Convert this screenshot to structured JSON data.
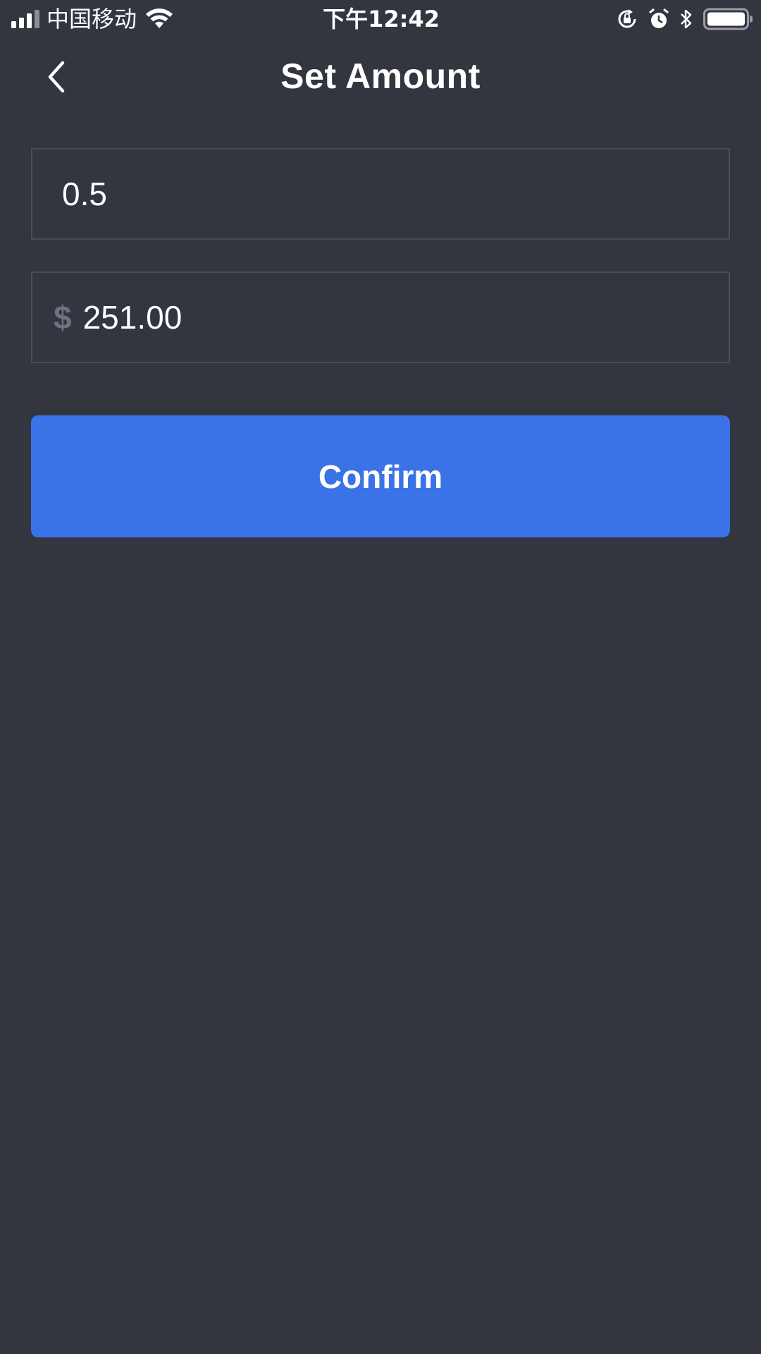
{
  "status_bar": {
    "carrier": "中国移动",
    "time": "下午12:42",
    "icons": [
      "signal-icon",
      "wifi-icon",
      "orientation-lock-icon",
      "alarm-icon",
      "bluetooth-icon",
      "battery-icon"
    ]
  },
  "nav": {
    "title": "Set Amount",
    "back_icon": "chevron-left-icon"
  },
  "form": {
    "amount_value": "0.5",
    "fiat_symbol": "$",
    "fiat_value": "251.00"
  },
  "actions": {
    "confirm_label": "Confirm"
  },
  "colors": {
    "background": "#33353f",
    "field_border": "#4a4c58",
    "accent": "#3a73e8",
    "muted": "#6f7282"
  }
}
